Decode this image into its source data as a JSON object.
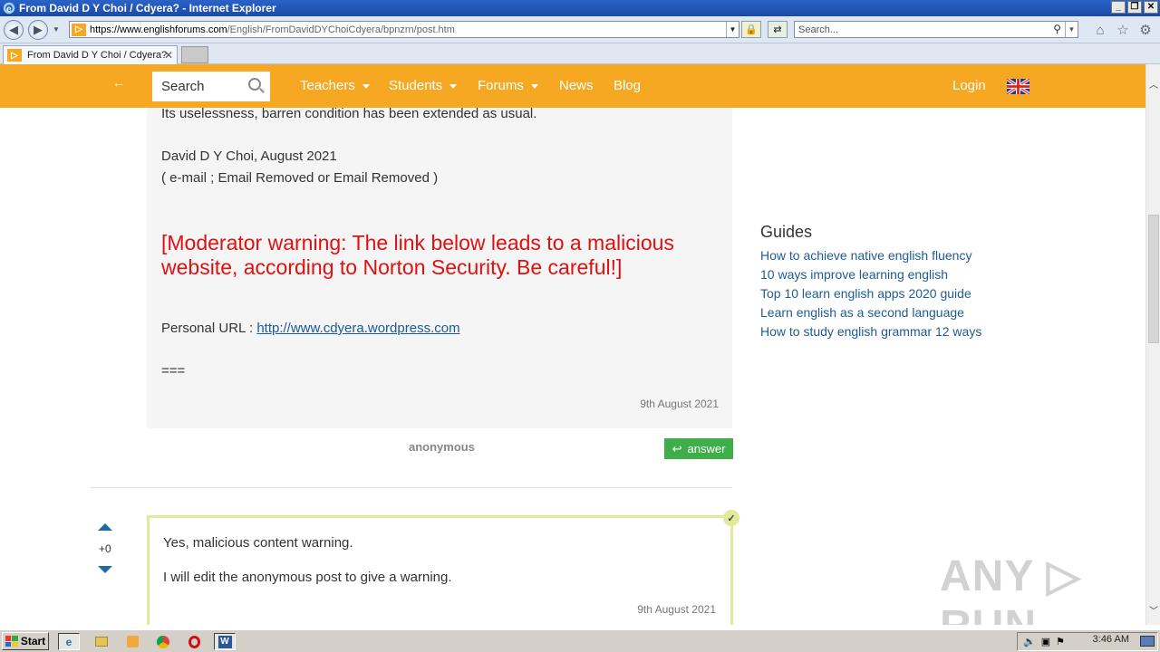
{
  "window": {
    "title": "From David D Y Choi / Cdyera? - Internet Explorer",
    "url_host": "https://www.englishforums.com",
    "url_rest": "/English/FromDavidDYChoiCdyera/bpnzrn/post.htm",
    "search_placeholder": "Search...",
    "tab_title": "From David D Y Choi / Cdyera?"
  },
  "site_header": {
    "back_label": "←",
    "search_placeholder": "Search",
    "nav": [
      {
        "label": "Teachers"
      },
      {
        "label": "Students"
      },
      {
        "label": "Forums"
      },
      {
        "label": "News"
      },
      {
        "label": "Blog"
      }
    ],
    "login_label": "Login"
  },
  "post": {
    "line1": "Its uselessness, barren condition has been extended as usual.",
    "signature": "David D Y Choi, August 2021",
    "email_line": "( e-mail ; Email Removed or Email Removed )",
    "moderator_warning": "[Moderator warning: The link below leads to a malicious website, according to Norton Security. Be careful!]",
    "url_label": "Personal URL : ",
    "url_link": "http://www.cdyera.wordpress.com",
    "separator": "===",
    "date": "9th August 2021",
    "author": "anonymous",
    "answer_label": "answer"
  },
  "reply": {
    "votes": "+0",
    "line1": "Yes, malicious content warning.",
    "line2": "I will edit the anonymous post to give a warning.",
    "date": "9th August 2021"
  },
  "sidebar": {
    "guides_title": "Guides",
    "guides": [
      "How to achieve native english fluency",
      "10 ways improve learning english",
      "Top 10 learn english apps 2020 guide",
      "Learn english as a second language",
      "How to study english grammar 12 ways"
    ]
  },
  "watermark": "ANY ▷ RUN",
  "taskbar": {
    "start_label": "Start",
    "clock": "3:46 AM"
  },
  "colors": {
    "brand_orange": "#f7a823",
    "warning_red": "#e01010",
    "answer_green": "#3fae49",
    "link_blue": "#1f5b93"
  }
}
